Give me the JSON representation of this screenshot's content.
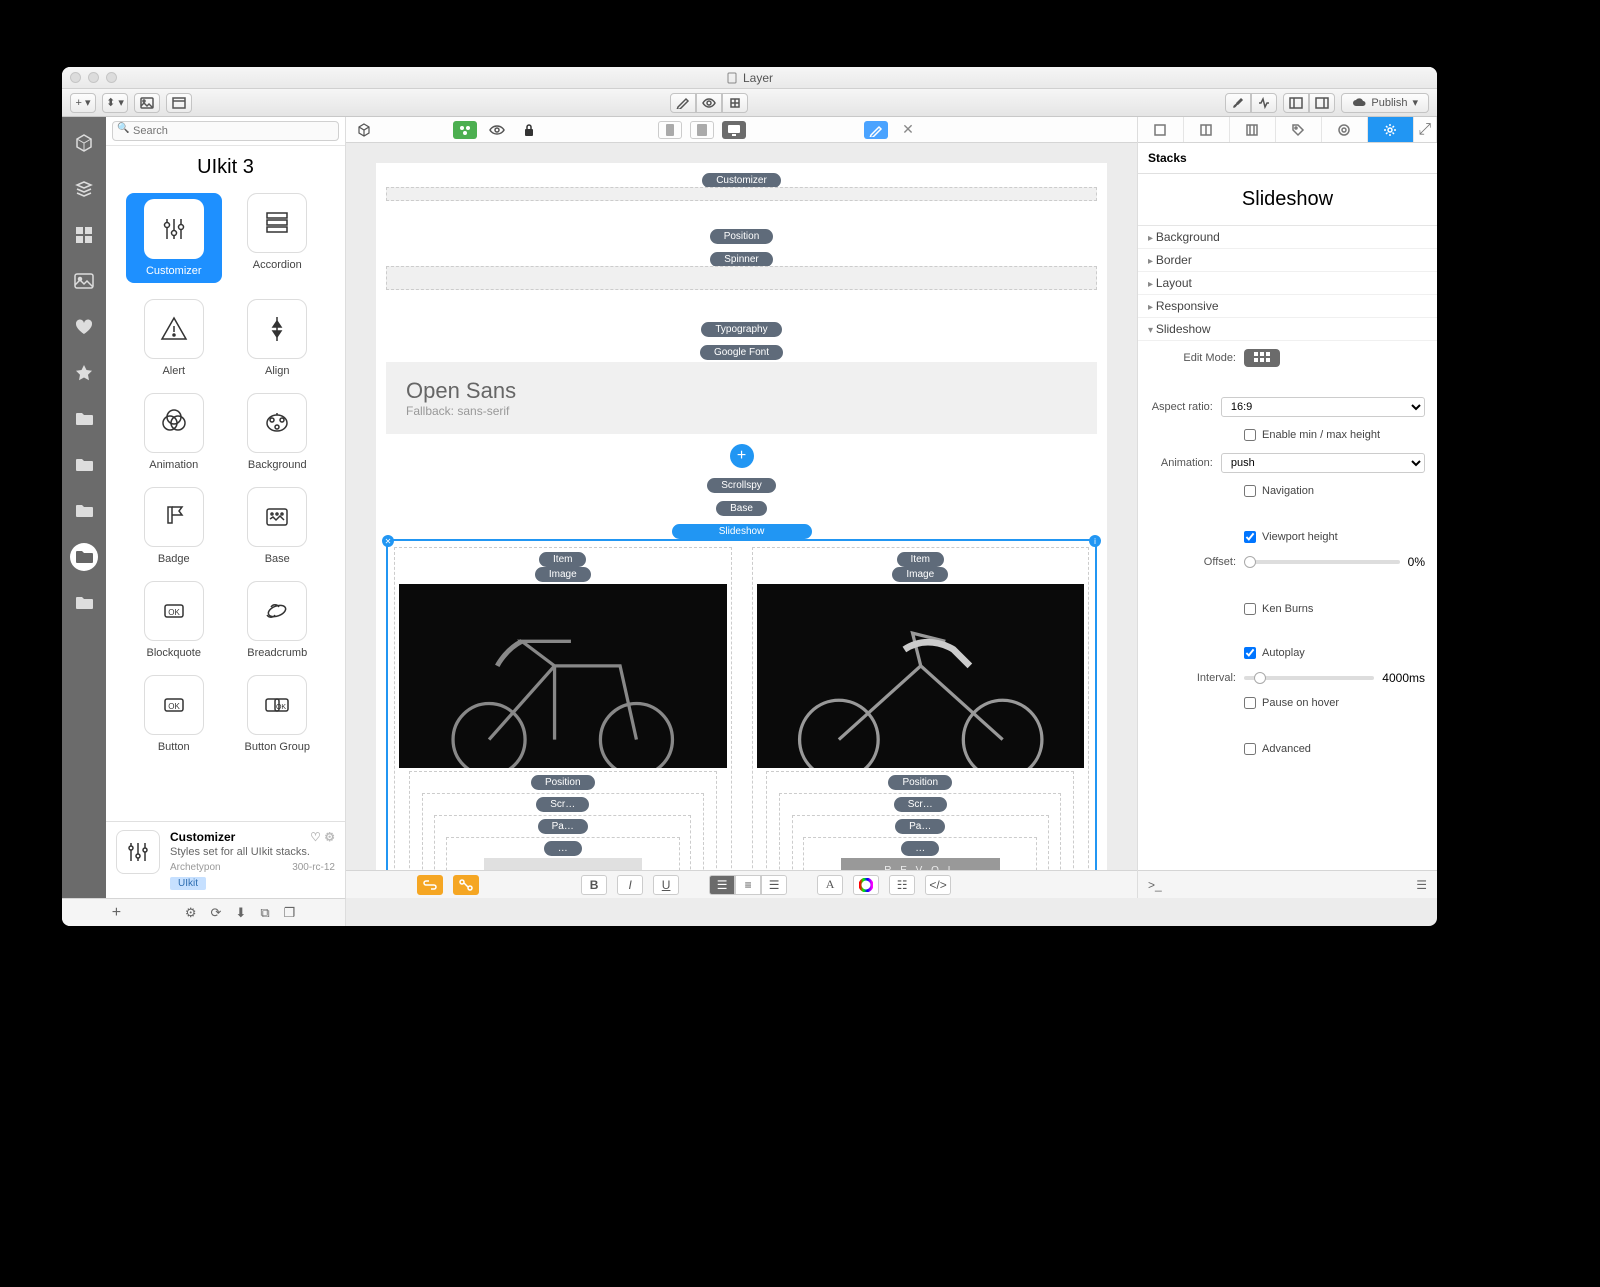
{
  "window": {
    "title": "Layer"
  },
  "toolbar": {
    "publish": "Publish"
  },
  "rail": {
    "icons": [
      "cube",
      "stacks",
      "grid",
      "image",
      "heart",
      "star",
      "folder",
      "folder",
      "folder",
      "folder-active",
      "folder"
    ]
  },
  "library": {
    "searchPlaceholder": "Search",
    "title": "UIkit 3",
    "items": [
      {
        "label": "Customizer",
        "icon": "sliders",
        "selected": true
      },
      {
        "label": "Accordion",
        "icon": "accordion"
      },
      {
        "label": "Alert",
        "icon": "alert"
      },
      {
        "label": "Align",
        "icon": "align"
      },
      {
        "label": "Animation",
        "icon": "animation"
      },
      {
        "label": "Background",
        "icon": "background"
      },
      {
        "label": "Badge",
        "icon": "badge"
      },
      {
        "label": "Base",
        "icon": "base"
      },
      {
        "label": "Blockquote",
        "icon": "blockquote"
      },
      {
        "label": "Breadcrumb",
        "icon": "breadcrumb"
      },
      {
        "label": "Button",
        "icon": "button"
      },
      {
        "label": "Button Group",
        "icon": "buttongroup"
      }
    ],
    "detail": {
      "title": "Customizer",
      "desc": "Styles set for all UIkit stacks.",
      "vendor": "Archetypon",
      "version": "300-rc-12",
      "tag": "UIkit"
    }
  },
  "canvas": {
    "blocks": {
      "customizer": "Customizer",
      "position": "Position",
      "spinner": "Spinner",
      "typography": "Typography",
      "googleFont": "Google Font",
      "fontName": "Open Sans",
      "fallback": "Fallback: sans-serif",
      "scrollspy": "Scrollspy",
      "base": "Base",
      "slideshow": "Slideshow",
      "item": "Item",
      "image": "Image",
      "pos2": "Position",
      "scr": "Scr…",
      "pa": "Pa…",
      "dots": "…",
      "revo": "R E V O L"
    }
  },
  "inspector": {
    "header": "Stacks",
    "title": "Slideshow",
    "sections": {
      "background": "Background",
      "border": "Border",
      "layout": "Layout",
      "responsive": "Responsive",
      "slideshow": "Slideshow"
    },
    "fields": {
      "editMode": "Edit Mode:",
      "aspectRatio": "Aspect ratio:",
      "aspectRatioValue": "16:9",
      "enableMinMax": "Enable min / max height",
      "animation": "Animation:",
      "animationValue": "push",
      "navigation": "Navigation",
      "viewportHeight": "Viewport height",
      "offset": "Offset:",
      "offsetValue": "0%",
      "kenBurns": "Ken Burns",
      "autoplay": "Autoplay",
      "interval": "Interval:",
      "intervalValue": "4000ms",
      "pauseHover": "Pause on hover",
      "advanced": "Advanced"
    },
    "footerPrompt": ">_"
  }
}
